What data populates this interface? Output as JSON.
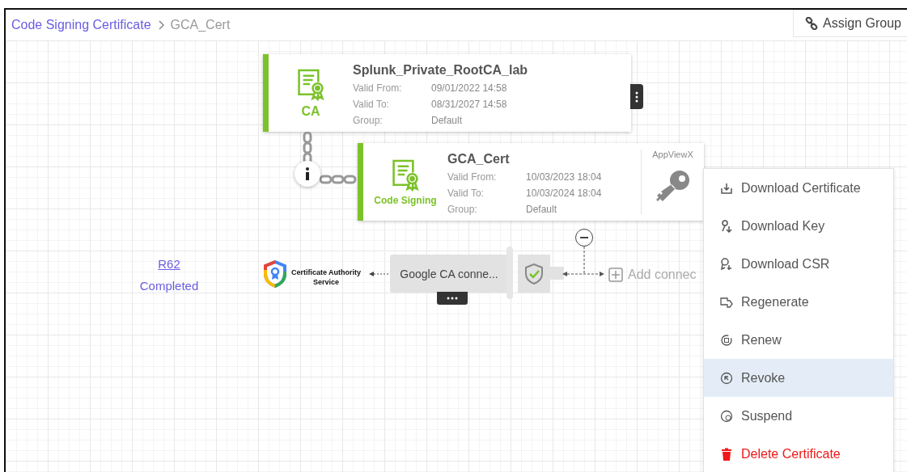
{
  "breadcrumb": [
    {
      "label": "Code Signing Certificate",
      "kind": "link"
    },
    {
      "label": "GCA_Cert",
      "kind": "current"
    }
  ],
  "toolbar": {
    "assign_group": "Assign Group"
  },
  "certificates": [
    {
      "kind": "ca",
      "type_label": "CA",
      "title": "Splunk_Private_RootCA_lab",
      "fields": [
        {
          "label": "Valid From:",
          "value": "09/01/2022 14:58"
        },
        {
          "label": "Valid To:",
          "value": "08/31/2027 14:58"
        },
        {
          "label": "Group:",
          "value": "Default"
        }
      ]
    },
    {
      "kind": "code_signing",
      "type_label": "Code Signing",
      "title": "GCA_Cert",
      "issuer": "AppViewX",
      "fields": [
        {
          "label": "Valid From:",
          "value": "10/03/2023 18:04"
        },
        {
          "label": "Valid To:",
          "value": "10/03/2024 18:04"
        },
        {
          "label": "Group:",
          "value": "Default"
        }
      ]
    }
  ],
  "request": {
    "id": "R62",
    "status": "Completed"
  },
  "ca_service": {
    "name": "Certificate Authority Service"
  },
  "connection": {
    "name": "Google CA conne..."
  },
  "add_connector": "Add connec",
  "context_menu": [
    {
      "kind": "download-cert",
      "label": "Download Certificate",
      "selected": false
    },
    {
      "kind": "download-key",
      "label": "Download Key",
      "selected": false
    },
    {
      "kind": "download-csr",
      "label": "Download CSR",
      "selected": false
    },
    {
      "kind": "regenerate",
      "label": "Regenerate",
      "selected": false
    },
    {
      "kind": "renew",
      "label": "Renew",
      "selected": false
    },
    {
      "kind": "revoke",
      "label": "Revoke",
      "selected": true
    },
    {
      "kind": "suspend",
      "label": "Suspend",
      "selected": false
    },
    {
      "kind": "delete",
      "label": "Delete Certificate",
      "selected": false
    }
  ]
}
